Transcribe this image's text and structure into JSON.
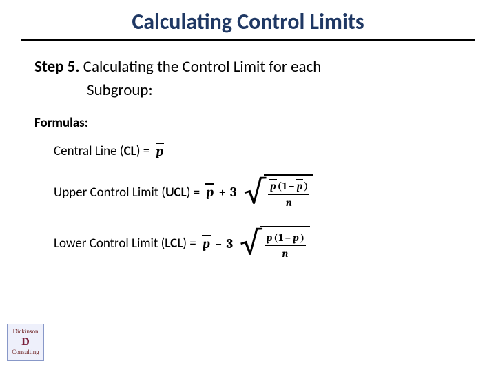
{
  "title": "Calculating Control Limits",
  "step": {
    "label": "Step 5.",
    "text_line1": " Calculating the Control Limit for each",
    "text_line2": "Subgroup:"
  },
  "formulas_heading": "Formulas:",
  "formulas": {
    "cl": {
      "label_pre": "Central Line (",
      "label_bold": "CL",
      "label_post": ") = "
    },
    "ucl": {
      "label_pre": "Upper Control Limit (",
      "label_bold": "UCL",
      "label_post": ") = ",
      "op": "+",
      "mult": "3"
    },
    "lcl": {
      "label_pre": "Lower Control Limit (",
      "label_bold": "LCL",
      "label_post": ") = ",
      "op": "−",
      "mult": "3"
    }
  },
  "symbols": {
    "pbar": "p",
    "one": "1",
    "minus": "−",
    "n": "n"
  },
  "logo": {
    "top": "Dickinson",
    "mid": "D",
    "bottom": "Consulting"
  }
}
